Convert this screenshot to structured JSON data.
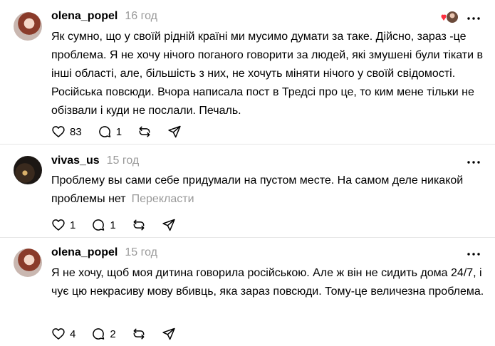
{
  "comments": [
    {
      "username": "olena_popel",
      "time": "16 год",
      "text": "Як сумно, що у своїй рідній країні ми мусимо думати за таке. Дійсно, зараз -це проблема. Я не хочу нічого поганого говорити за людей, які змушені були тікати в інші області, але, більшість з них, не хочуть міняти нічого у своїй свідомості. Російська повсюди. Вчора написала пост в Тредсі про це, то ким мене тільки не обізвали і куди не послали. Печаль.",
      "likes": "83",
      "replies": "1",
      "avatar_icon": "profile-photo"
    },
    {
      "username": "vivas_us",
      "time": "15 год",
      "text": "Проблему вы сами себе придумали на пустом месте. На самом деле никакой проблемы нет",
      "translate": "Перекласти",
      "likes": "1",
      "replies": "1",
      "avatar_icon": "profile-photo"
    },
    {
      "username": "olena_popel",
      "time": "15 год",
      "text": "Я не хочу, щоб моя дитина говорила російською. Але ж він не сидить дома 24/7, і чує цю некрасиву мову вбивць, яка зараз повсюди. Тому-це величезна проблема.",
      "likes": "4",
      "replies": "2",
      "avatar_icon": "profile-photo"
    }
  ],
  "colors": {
    "muted": "#999999",
    "divider": "#e6e6e6",
    "heart_red": "#ff3040"
  }
}
